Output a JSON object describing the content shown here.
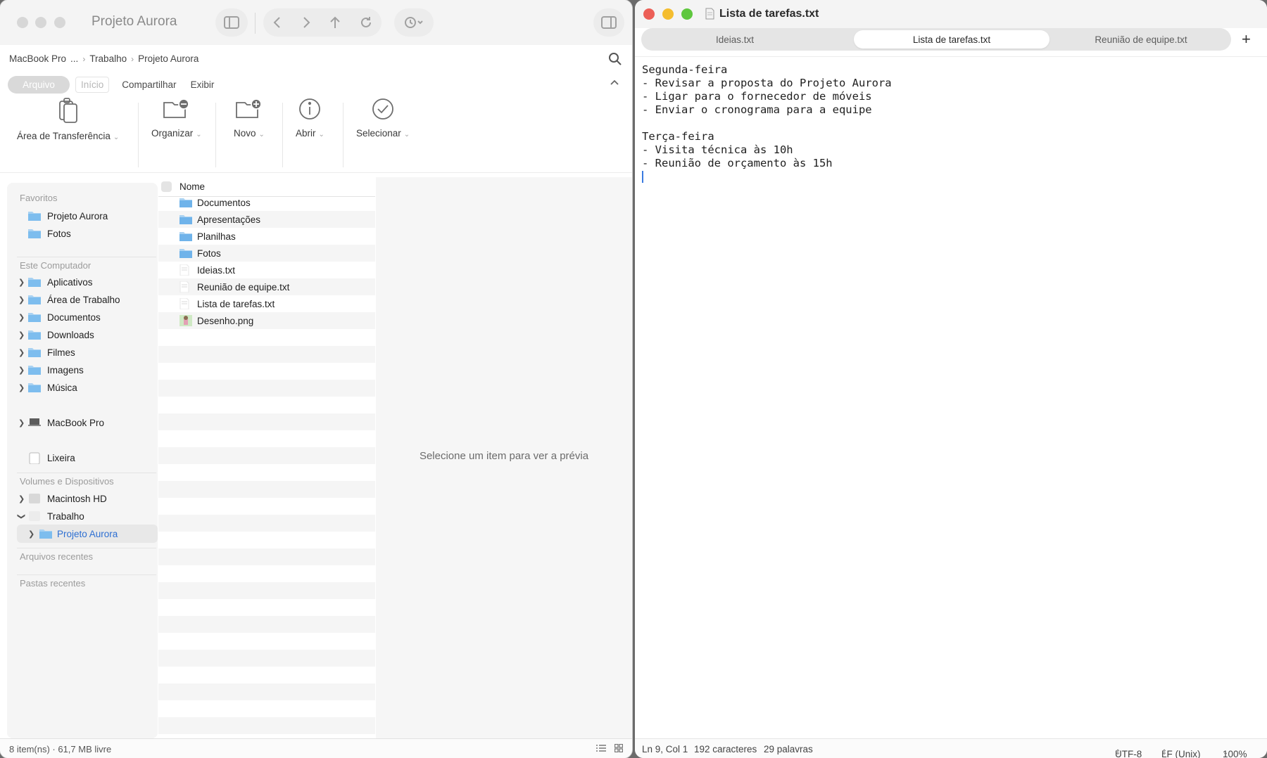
{
  "finder": {
    "title": "Projeto Aurora",
    "breadcrumb": [
      "MacBook Pro",
      "...",
      "Trabalho",
      "Projeto Aurora"
    ],
    "ribbon_tabs": [
      "Arquivo",
      "Início",
      "Compartilhar",
      "Exibir"
    ],
    "ribbon_groups": [
      {
        "label": "Área de Transferência",
        "icon": "clipboard-icon"
      },
      {
        "label": "Organizar",
        "icon": "folder-minus-icon"
      },
      {
        "label": "Novo",
        "icon": "folder-plus-icon"
      },
      {
        "label": "Abrir",
        "icon": "info-icon"
      },
      {
        "label": "Selecionar",
        "icon": "checkmark-circle-icon"
      }
    ],
    "sidebar": {
      "favorites_title": "Favoritos",
      "favorites": [
        "Projeto Aurora",
        "Fotos"
      ],
      "computer_title": "Este Computador",
      "computer": [
        "Aplicativos",
        "Área de Trabalho",
        "Documentos",
        "Downloads",
        "Filmes",
        "Imagens",
        "Música"
      ],
      "macbook": "MacBook Pro",
      "trash": "Lixeira",
      "volumes_title": "Volumes e Dispositivos",
      "volumes": [
        "Macintosh HD",
        "Trabalho"
      ],
      "selected": "Projeto Aurora",
      "recent_files": "Arquivos recentes",
      "recent_folders": "Pastas recentes"
    },
    "list_header": "Nome",
    "files": [
      {
        "name": "Documentos",
        "type": "folder"
      },
      {
        "name": "Apresentações",
        "type": "folder"
      },
      {
        "name": "Planilhas",
        "type": "folder"
      },
      {
        "name": "Fotos",
        "type": "folder"
      },
      {
        "name": "Ideias.txt",
        "type": "text"
      },
      {
        "name": "Reunião de equipe.txt",
        "type": "text"
      },
      {
        "name": "Lista de tarefas.txt",
        "type": "text"
      },
      {
        "name": "Desenho.png",
        "type": "image"
      }
    ],
    "preview_text": "Selecione um item para ver a prévia",
    "status": "8 item(ns)  ·  61,7 MB livre"
  },
  "editor": {
    "title": "Lista de tarefas.txt",
    "tabs": [
      "Ideias.txt",
      "Lista de tarefas.txt",
      "Reunião de equipe.txt"
    ],
    "active_tab": 1,
    "content": "Segunda-feira\n- Revisar a proposta do Projeto Aurora\n- Ligar para o fornecedor de móveis\n- Enviar o cronograma para a equipe\n\nTerça-feira\n- Visita técnica às 10h\n- Reunião de orçamento às 15h",
    "status": {
      "position": "Ln 9, Col 1",
      "chars": "192 caracteres",
      "words": "29 palavras",
      "encoding": "UTF-8",
      "line_ending": "LF (Unix)",
      "zoom": "100%"
    }
  },
  "colors": {
    "close": "#ec5f57",
    "minimize": "#f4bd2f",
    "maximize": "#5fc73e",
    "folder": "#6fb3ea",
    "selected_text": "#2d6fd2"
  }
}
